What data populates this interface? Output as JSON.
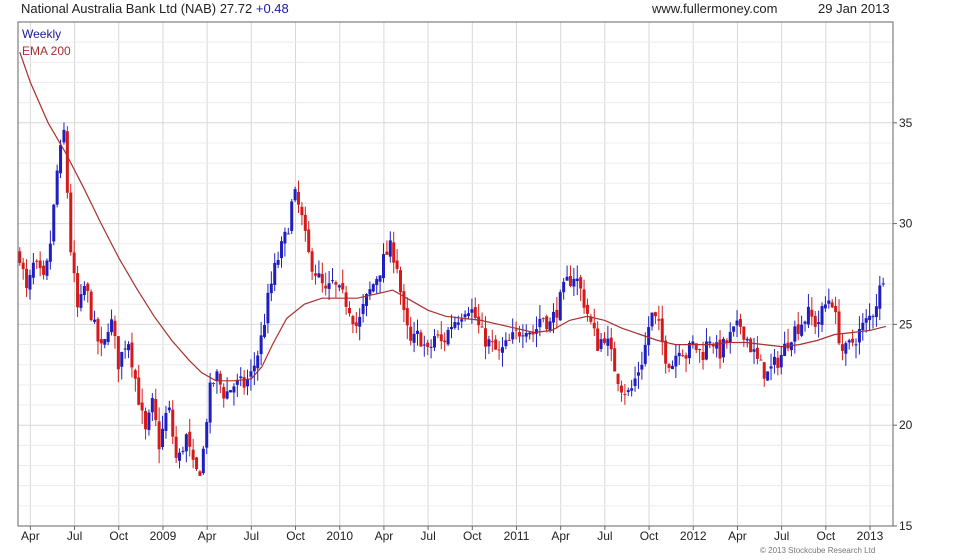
{
  "header": {
    "title": "National Australia Bank Ltd (NAB) 27.72",
    "change": "+0.48",
    "site": "www.fullermoney.com",
    "date": "29 Jan 2013"
  },
  "copyright": "© 2013 Stockcube Research Ltd",
  "colors": {
    "up": "#1f1fbf",
    "down": "#d41a1a",
    "ema": "#a83030",
    "grid": "#d8d8d8",
    "frame": "#666666"
  },
  "chart_data": {
    "type": "candlestick",
    "legend": [
      "Weekly",
      "EMA 200"
    ],
    "legend_placement": "top-left",
    "grid": true,
    "ylim": [
      15,
      40
    ],
    "yticks": [
      15,
      20,
      25,
      30,
      35
    ],
    "y_axis_side": "right",
    "xlim": [
      2008.18,
      2013.13
    ],
    "xticks": [
      {
        "label": "Apr",
        "t": 2008.25
      },
      {
        "label": "Jul",
        "t": 2008.5
      },
      {
        "label": "Oct",
        "t": 2008.75
      },
      {
        "label": "2009",
        "t": 2009.0
      },
      {
        "label": "Apr",
        "t": 2009.25
      },
      {
        "label": "Jul",
        "t": 2009.5
      },
      {
        "label": "Oct",
        "t": 2009.75
      },
      {
        "label": "2010",
        "t": 2010.0
      },
      {
        "label": "Apr",
        "t": 2010.25
      },
      {
        "label": "Jul",
        "t": 2010.5
      },
      {
        "label": "Oct",
        "t": 2010.75
      },
      {
        "label": "2011",
        "t": 2011.0
      },
      {
        "label": "Apr",
        "t": 2011.25
      },
      {
        "label": "Jul",
        "t": 2011.5
      },
      {
        "label": "Oct",
        "t": 2011.75
      },
      {
        "label": "2012",
        "t": 2012.0
      },
      {
        "label": "Apr",
        "t": 2012.25
      },
      {
        "label": "Jul",
        "t": 2012.5
      },
      {
        "label": "Oct",
        "t": 2012.75
      },
      {
        "label": "2013",
        "t": 2013.0
      }
    ],
    "price_path": [
      [
        2008.19,
        28.5
      ],
      [
        2008.23,
        26.5
      ],
      [
        2008.27,
        28.0
      ],
      [
        2008.33,
        27.0
      ],
      [
        2008.37,
        29.5
      ],
      [
        2008.4,
        32.5
      ],
      [
        2008.44,
        34.5
      ],
      [
        2008.48,
        28.5
      ],
      [
        2008.52,
        25.5
      ],
      [
        2008.56,
        27.0
      ],
      [
        2008.62,
        24.5
      ],
      [
        2008.66,
        23.5
      ],
      [
        2008.7,
        25.5
      ],
      [
        2008.75,
        23.0
      ],
      [
        2008.8,
        24.5
      ],
      [
        2008.85,
        22.0
      ],
      [
        2008.9,
        19.5
      ],
      [
        2008.94,
        21.0
      ],
      [
        2008.98,
        19.0
      ],
      [
        2009.03,
        21.0
      ],
      [
        2009.08,
        18.0
      ],
      [
        2009.13,
        19.5
      ],
      [
        2009.18,
        17.5
      ],
      [
        2009.22,
        18.0
      ],
      [
        2009.26,
        21.5
      ],
      [
        2009.3,
        22.5
      ],
      [
        2009.35,
        21.5
      ],
      [
        2009.4,
        22.0
      ],
      [
        2009.46,
        22.0
      ],
      [
        2009.5,
        22.5
      ],
      [
        2009.55,
        24.0
      ],
      [
        2009.6,
        26.5
      ],
      [
        2009.64,
        28.0
      ],
      [
        2009.7,
        29.5
      ],
      [
        2009.74,
        31.5
      ],
      [
        2009.78,
        30.5
      ],
      [
        2009.82,
        28.5
      ],
      [
        2009.87,
        27.5
      ],
      [
        2009.92,
        26.5
      ],
      [
        2009.96,
        27.0
      ],
      [
        2010.0,
        26.5
      ],
      [
        2010.05,
        26.0
      ],
      [
        2010.1,
        24.8
      ],
      [
        2010.14,
        26.0
      ],
      [
        2010.19,
        27.0
      ],
      [
        2010.24,
        28.0
      ],
      [
        2010.28,
        28.8
      ],
      [
        2010.32,
        28.3
      ],
      [
        2010.36,
        25.5
      ],
      [
        2010.4,
        24.0
      ],
      [
        2010.45,
        24.5
      ],
      [
        2010.5,
        23.5
      ],
      [
        2010.54,
        24.5
      ],
      [
        2010.58,
        24.0
      ],
      [
        2010.63,
        25.0
      ],
      [
        2010.68,
        25.5
      ],
      [
        2010.72,
        26.0
      ],
      [
        2010.76,
        25.5
      ],
      [
        2010.8,
        24.5
      ],
      [
        2010.85,
        24.0
      ],
      [
        2010.9,
        23.5
      ],
      [
        2010.95,
        24.0
      ],
      [
        2011.0,
        24.5
      ],
      [
        2011.05,
        25.0
      ],
      [
        2011.1,
        24.5
      ],
      [
        2011.14,
        25.5
      ],
      [
        2011.19,
        25.0
      ],
      [
        2011.24,
        26.0
      ],
      [
        2011.28,
        27.0
      ],
      [
        2011.33,
        27.5
      ],
      [
        2011.37,
        26.5
      ],
      [
        2011.42,
        25.0
      ],
      [
        2011.46,
        24.0
      ],
      [
        2011.5,
        24.5
      ],
      [
        2011.55,
        23.0
      ],
      [
        2011.59,
        22.0
      ],
      [
        2011.64,
        21.5
      ],
      [
        2011.68,
        22.5
      ],
      [
        2011.72,
        23.5
      ],
      [
        2011.76,
        25.5
      ],
      [
        2011.8,
        25.0
      ],
      [
        2011.84,
        23.5
      ],
      [
        2011.88,
        23.0
      ],
      [
        2011.92,
        24.0
      ],
      [
        2011.96,
        23.5
      ],
      [
        2012.0,
        24.0
      ],
      [
        2012.05,
        23.5
      ],
      [
        2012.1,
        24.5
      ],
      [
        2012.14,
        23.5
      ],
      [
        2012.18,
        24.0
      ],
      [
        2012.22,
        24.5
      ],
      [
        2012.27,
        25.0
      ],
      [
        2012.32,
        24.0
      ],
      [
        2012.37,
        23.0
      ],
      [
        2012.42,
        22.5
      ],
      [
        2012.46,
        23.0
      ],
      [
        2012.5,
        23.5
      ],
      [
        2012.55,
        24.5
      ],
      [
        2012.6,
        25.0
      ],
      [
        2012.65,
        25.5
      ],
      [
        2012.7,
        25.0
      ],
      [
        2012.75,
        26.0
      ],
      [
        2012.78,
        26.5
      ],
      [
        2012.81,
        25.0
      ],
      [
        2012.85,
        23.5
      ],
      [
        2012.89,
        24.0
      ],
      [
        2012.93,
        24.5
      ],
      [
        2012.97,
        25.0
      ],
      [
        2013.01,
        25.5
      ],
      [
        2013.05,
        26.5
      ],
      [
        2013.08,
        27.7
      ]
    ],
    "ema_path": [
      [
        2008.19,
        38.5
      ],
      [
        2008.25,
        37.0
      ],
      [
        2008.35,
        35.0
      ],
      [
        2008.45,
        33.5
      ],
      [
        2008.55,
        31.8
      ],
      [
        2008.65,
        30.0
      ],
      [
        2008.75,
        28.3
      ],
      [
        2008.85,
        26.8
      ],
      [
        2008.95,
        25.4
      ],
      [
        2009.05,
        24.2
      ],
      [
        2009.15,
        23.2
      ],
      [
        2009.22,
        22.6
      ],
      [
        2009.3,
        22.2
      ],
      [
        2009.4,
        22.2
      ],
      [
        2009.5,
        22.3
      ],
      [
        2009.56,
        22.9
      ],
      [
        2009.62,
        24.0
      ],
      [
        2009.7,
        25.3
      ],
      [
        2009.8,
        26.0
      ],
      [
        2009.9,
        26.3
      ],
      [
        2010.0,
        26.3
      ],
      [
        2010.1,
        26.3
      ],
      [
        2010.2,
        26.5
      ],
      [
        2010.3,
        26.7
      ],
      [
        2010.4,
        26.2
      ],
      [
        2010.5,
        25.7
      ],
      [
        2010.6,
        25.4
      ],
      [
        2010.7,
        25.3
      ],
      [
        2010.8,
        25.2
      ],
      [
        2010.9,
        25.0
      ],
      [
        2011.0,
        24.8
      ],
      [
        2011.1,
        24.6
      ],
      [
        2011.2,
        24.7
      ],
      [
        2011.3,
        25.2
      ],
      [
        2011.4,
        25.4
      ],
      [
        2011.5,
        25.2
      ],
      [
        2011.6,
        24.8
      ],
      [
        2011.7,
        24.5
      ],
      [
        2011.8,
        24.2
      ],
      [
        2011.9,
        24.0
      ],
      [
        2012.0,
        24.0
      ],
      [
        2012.1,
        24.0
      ],
      [
        2012.2,
        24.1
      ],
      [
        2012.3,
        24.1
      ],
      [
        2012.4,
        24.0
      ],
      [
        2012.5,
        23.9
      ],
      [
        2012.6,
        24.0
      ],
      [
        2012.7,
        24.2
      ],
      [
        2012.8,
        24.5
      ],
      [
        2012.9,
        24.6
      ],
      [
        2013.0,
        24.7
      ],
      [
        2013.09,
        24.9
      ]
    ]
  }
}
